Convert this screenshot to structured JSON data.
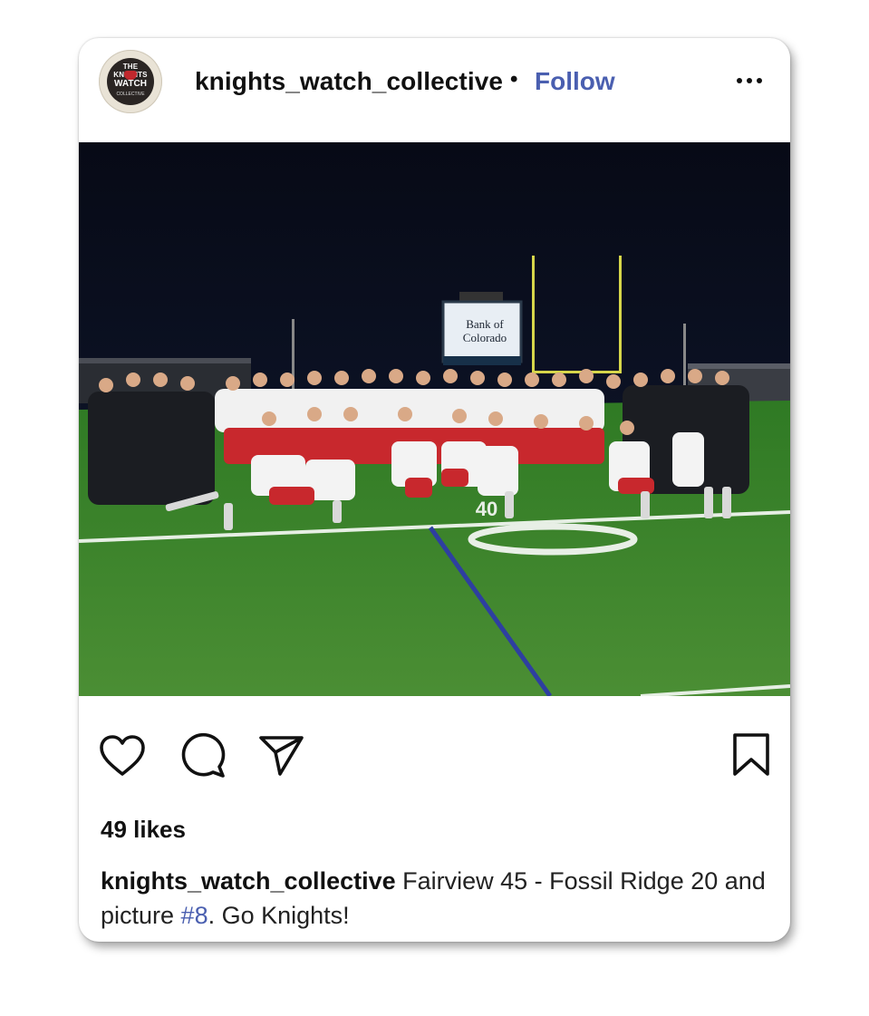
{
  "post": {
    "username": "knights_watch_collective",
    "separator": "•",
    "follow_label": "Follow",
    "avatar": {
      "line1": "THE KNIGHTS",
      "line2": "WATCH",
      "line3": "COLLECTIVE"
    },
    "photo": {
      "scoreboard_line1": "Bank of",
      "scoreboard_line2": "Colorado",
      "field_number": "40"
    },
    "likes": "49 likes",
    "caption": {
      "username": "knights_watch_collective",
      "text_before": " Fairview 45 - Fossil Ridge 20 and picture ",
      "hashtag": "#8",
      "text_after": ". Go Knights!"
    }
  },
  "icons": {
    "like": "heart-icon",
    "comment": "comment-icon",
    "share": "send-icon",
    "save": "bookmark-icon",
    "more": "more-icon"
  },
  "colors": {
    "follow": "#4a5fb0",
    "hashtag": "#4a5fb0",
    "text": "#111111",
    "jersey_red": "#c8282d",
    "field_green": "#3f8a2e"
  }
}
